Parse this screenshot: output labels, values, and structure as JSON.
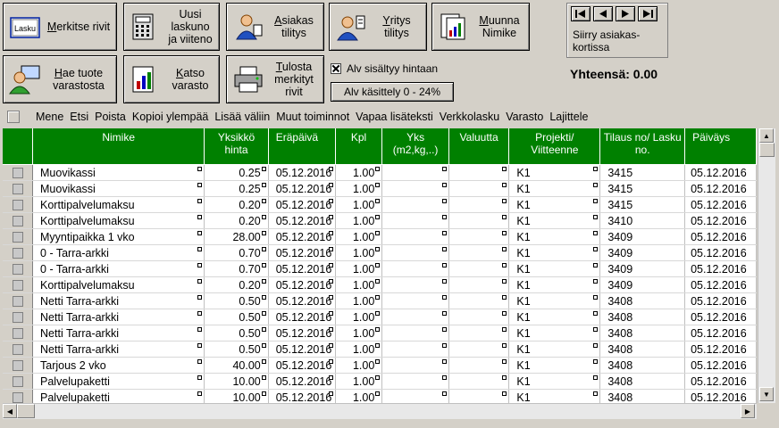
{
  "toolbar": {
    "row1": [
      {
        "label_u": "M",
        "label_rest": "erkitse rivit",
        "icon": "invoice-icon",
        "name": "mark-rows-button"
      },
      {
        "label": "Uusi laskuno ja viiteno",
        "icon": "calculator-icon",
        "name": "new-invoice-number-button"
      },
      {
        "label_u": "A",
        "label_rest": "siakas tilitys",
        "icon": "customer-icon",
        "name": "customer-account-button"
      },
      {
        "label_u": "Y",
        "label_rest": "ritys tilitys",
        "icon": "company-icon",
        "name": "company-account-button"
      },
      {
        "label_u": "M",
        "label_rest": "uunna Nimike",
        "icon": "report-icon",
        "name": "convert-item-button"
      }
    ],
    "row2": [
      {
        "label_u": "H",
        "label_rest": "ae tuote varastosta",
        "icon": "user-computer-icon",
        "name": "fetch-product-button"
      },
      {
        "label_u": "K",
        "label_rest": "atso varasto",
        "icon": "chart-icon",
        "name": "view-stock-button"
      },
      {
        "label_u": "T",
        "label_rest": "ulosta merkityt rivit",
        "icon": "printer-icon",
        "name": "print-marked-button"
      }
    ],
    "mark_rows_prefix": "Lasku"
  },
  "nav": {
    "text": "Siirry asiakas-kortissa"
  },
  "alv": {
    "checkbox_label": "Alv sisältyy hintaan",
    "button_label": "Alv käsittely 0 - 24%"
  },
  "total": "Yhteensä: 0.00",
  "menu": [
    "Mene",
    "Etsi",
    "Poista",
    "Kopioi ylempää",
    "Lisää väliin",
    "Muut toiminnot",
    "Vapaa lisäteksti",
    "Verkkolasku",
    "Varasto",
    "Lajittele"
  ],
  "columns": [
    "Nimike",
    "Yksikkö hinta",
    "Eräpäivä",
    "Kpl",
    "Yks (m2,kg,..)",
    "Valuutta",
    "Projekti/ Viitteenne",
    "Tilaus no/ Lasku no.",
    "Päiväys"
  ],
  "rows": [
    [
      "Muovikassi",
      "0.25",
      "05.12.2016",
      "1.00",
      "",
      "",
      "K1",
      "3415",
      "05.12.2016"
    ],
    [
      "Muovikassi",
      "0.25",
      "05.12.2016",
      "1.00",
      "",
      "",
      "K1",
      "3415",
      "05.12.2016"
    ],
    [
      "Korttipalvelumaksu",
      "0.20",
      "05.12.2016",
      "1.00",
      "",
      "",
      "K1",
      "3415",
      "05.12.2016"
    ],
    [
      "Korttipalvelumaksu",
      "0.20",
      "05.12.2016",
      "1.00",
      "",
      "",
      "K1",
      "3410",
      "05.12.2016"
    ],
    [
      "Myyntipaikka 1 vko",
      "28.00",
      "05.12.2016",
      "1.00",
      "",
      "",
      "K1",
      "3409",
      "05.12.2016"
    ],
    [
      "0 - Tarra-arkki",
      "0.70",
      "05.12.2016",
      "1.00",
      "",
      "",
      "K1",
      "3409",
      "05.12.2016"
    ],
    [
      "0 - Tarra-arkki",
      "0.70",
      "05.12.2016",
      "1.00",
      "",
      "",
      "K1",
      "3409",
      "05.12.2016"
    ],
    [
      "Korttipalvelumaksu",
      "0.20",
      "05.12.2016",
      "1.00",
      "",
      "",
      "K1",
      "3409",
      "05.12.2016"
    ],
    [
      "Netti Tarra-arkki",
      "0.50",
      "05.12.2016",
      "1.00",
      "",
      "",
      "K1",
      "3408",
      "05.12.2016"
    ],
    [
      "Netti Tarra-arkki",
      "0.50",
      "05.12.2016",
      "1.00",
      "",
      "",
      "K1",
      "3408",
      "05.12.2016"
    ],
    [
      "Netti Tarra-arkki",
      "0.50",
      "05.12.2016",
      "1.00",
      "",
      "",
      "K1",
      "3408",
      "05.12.2016"
    ],
    [
      "Netti Tarra-arkki",
      "0.50",
      "05.12.2016",
      "1.00",
      "",
      "",
      "K1",
      "3408",
      "05.12.2016"
    ],
    [
      "Tarjous 2 vko",
      "40.00",
      "05.12.2016",
      "1.00",
      "",
      "",
      "K1",
      "3408",
      "05.12.2016"
    ],
    [
      "Palvelupaketti",
      "10.00",
      "05.12.2016",
      "1.00",
      "",
      "",
      "K1",
      "3408",
      "05.12.2016"
    ],
    [
      "Palvelupaketti",
      "10.00",
      "05.12.2016",
      "1.00",
      "",
      "",
      "K1",
      "3408",
      "05.12.2016"
    ]
  ],
  "colors": {
    "header": "#008000",
    "face": "#d4d0c8"
  }
}
